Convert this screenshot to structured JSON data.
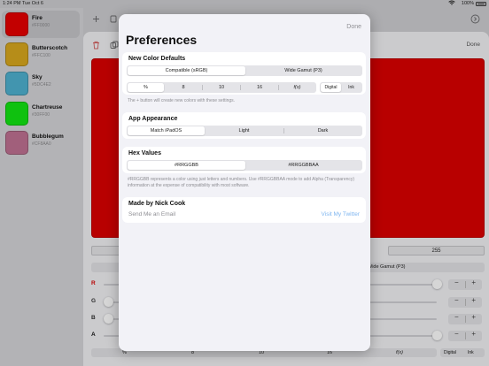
{
  "status_bar": {
    "time": "1:24 PM",
    "date": "Tue Oct 6",
    "battery": "100%"
  },
  "sidebar": {
    "colors": [
      {
        "name": "Fire",
        "hex": "#FF0000",
        "swatch": "#e80000",
        "selected": true
      },
      {
        "name": "Butterscotch",
        "hex": "#FFC100",
        "swatch": "#d9a81e",
        "selected": false
      },
      {
        "name": "Sky",
        "hex": "#5DC4E2",
        "swatch": "#4fb2d1",
        "selected": false
      },
      {
        "name": "Chartreuse",
        "hex": "#30FF00",
        "swatch": "#12e612",
        "selected": false
      },
      {
        "name": "Bubblegum",
        "hex": "#CF8AA0",
        "swatch": "#c07293",
        "selected": false
      }
    ]
  },
  "background": {
    "done_label": "Done",
    "preview_color": "#dc0000",
    "value_box": "255",
    "gamut_label": "Wide Gamut (P3)",
    "sliders": [
      {
        "label": "R",
        "color": "#dc0000",
        "level": 1.0
      },
      {
        "label": "G",
        "color": "#333333",
        "level": 0.0
      },
      {
        "label": "B",
        "color": "#333333",
        "level": 0.0
      },
      {
        "label": "A",
        "color": "#111111",
        "level": 1.0
      }
    ],
    "stepper": {
      "minus": "−",
      "plus": "+"
    },
    "format_options": [
      "%",
      "8",
      "10",
      "16",
      "f(x)"
    ],
    "mode_options": [
      "Digital",
      "Ink"
    ]
  },
  "preferences": {
    "title": "Preferences",
    "done_label": "Done",
    "new_color_defaults": {
      "title": "New Color Defaults",
      "gamut_options": [
        "Compatible (sRGB)",
        "Wide Gamut (P3)"
      ],
      "gamut_selected": 0,
      "format_options": [
        "%",
        "8",
        "10",
        "16",
        "f(x)"
      ],
      "format_selected": 0,
      "mode_options": [
        "Digital",
        "Ink"
      ],
      "mode_selected": 0,
      "note": "The + button will create new colors with these settings."
    },
    "app_appearance": {
      "title": "App Appearance",
      "options": [
        "Match iPadOS",
        "Light",
        "Dark"
      ],
      "selected": 0
    },
    "hex_values": {
      "title": "Hex Values",
      "options": [
        "#RRGGBB",
        "#RRGGBBAA"
      ],
      "selected": 0,
      "note": "#RRGGBB represents a color using just letters and numbers. Use #RRGGBBAA mode to add Alpha (Transparency) information at the expense of compatibility with most software."
    },
    "made_by": {
      "title": "Made by Nick Cook",
      "email_label": "Send Me an Email",
      "twitter_label": "Visit My Twitter"
    }
  }
}
